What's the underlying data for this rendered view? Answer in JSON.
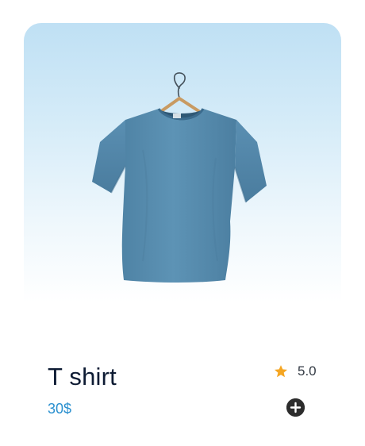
{
  "product": {
    "name": "T shirt",
    "price": "30$",
    "rating": "5.0",
    "image_icon": "t-shirt-on-hanger"
  },
  "icons": {
    "rating": "star-icon",
    "add": "plus-circle-icon"
  },
  "colors": {
    "title": "#0d1b33",
    "price": "#2a90cf",
    "star": "#f5a623",
    "add_button": "#2c2c2c",
    "image_background_top": "#bfe0f4",
    "shirt": "#5a8fb0"
  }
}
